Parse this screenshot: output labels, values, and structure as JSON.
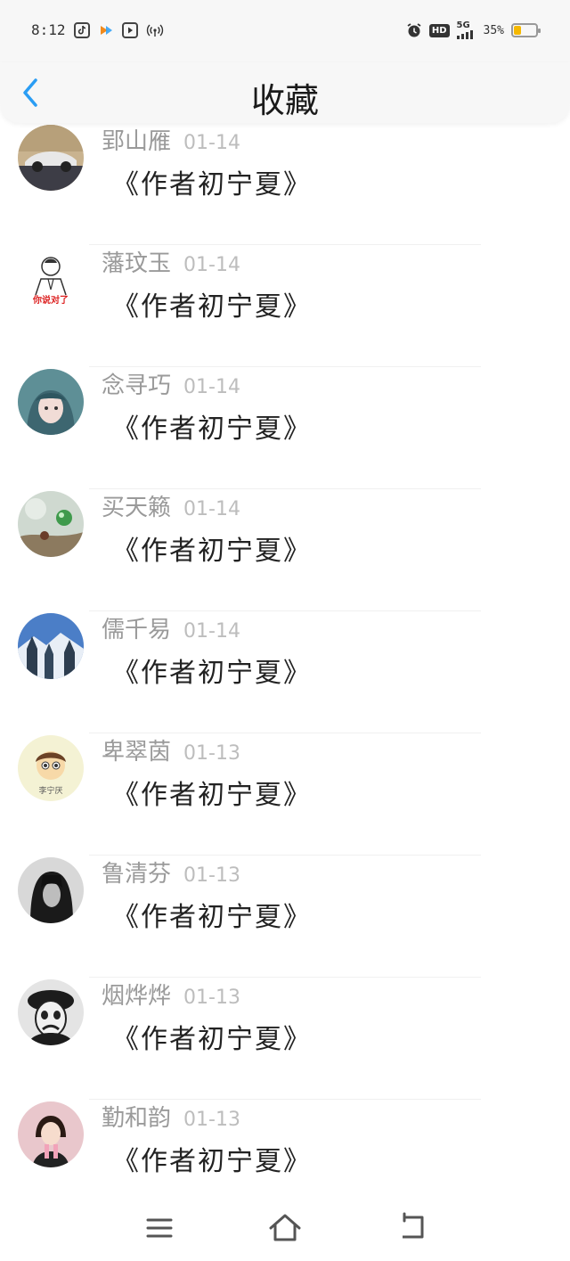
{
  "status_bar": {
    "time": "8:12",
    "hd_label": "HD",
    "network": "5G",
    "battery_text": "35%",
    "battery_level": 0.35,
    "battery_color": "#f5b800",
    "icons": [
      "tiktok-icon",
      "arrow-app-icon",
      "video-play-icon",
      "hotspot-icon",
      "alarm-icon"
    ]
  },
  "header": {
    "title": "收藏",
    "back_icon": "chevron-left-icon",
    "accent_color": "#2a9df4"
  },
  "items": [
    {
      "name": "郢山雁",
      "date": "01-14",
      "title": "《作者初宁夏》",
      "avatar": "car-avatar"
    },
    {
      "name": "藩玟玉",
      "date": "01-14",
      "title": "《作者初宁夏》",
      "avatar": "meme-avatar",
      "avatar_caption": "你说对了"
    },
    {
      "name": "念寻巧",
      "date": "01-14",
      "title": "《作者初宁夏》",
      "avatar": "anime-girl-avatar"
    },
    {
      "name": "买天籁",
      "date": "01-14",
      "title": "《作者初宁夏》",
      "avatar": "marble-avatar"
    },
    {
      "name": "儒千易",
      "date": "01-14",
      "title": "《作者初宁夏》",
      "avatar": "snow-forest-avatar"
    },
    {
      "name": "卑翠茵",
      "date": "01-13",
      "title": "《作者初宁夏》",
      "avatar": "cartoon-avatar",
      "avatar_caption": "李宁厌"
    },
    {
      "name": "鲁清芬",
      "date": "01-13",
      "title": "《作者初宁夏》",
      "avatar": "dark-hair-avatar"
    },
    {
      "name": "烟烨烨",
      "date": "01-13",
      "title": "《作者初宁夏》",
      "avatar": "sad-clown-avatar"
    },
    {
      "name": "勤和韵",
      "date": "01-13",
      "title": "《作者初宁夏》",
      "avatar": "child-avatar"
    }
  ],
  "nav_bar": {
    "icons": [
      "menu-icon",
      "home-icon",
      "back-nav-icon"
    ]
  }
}
